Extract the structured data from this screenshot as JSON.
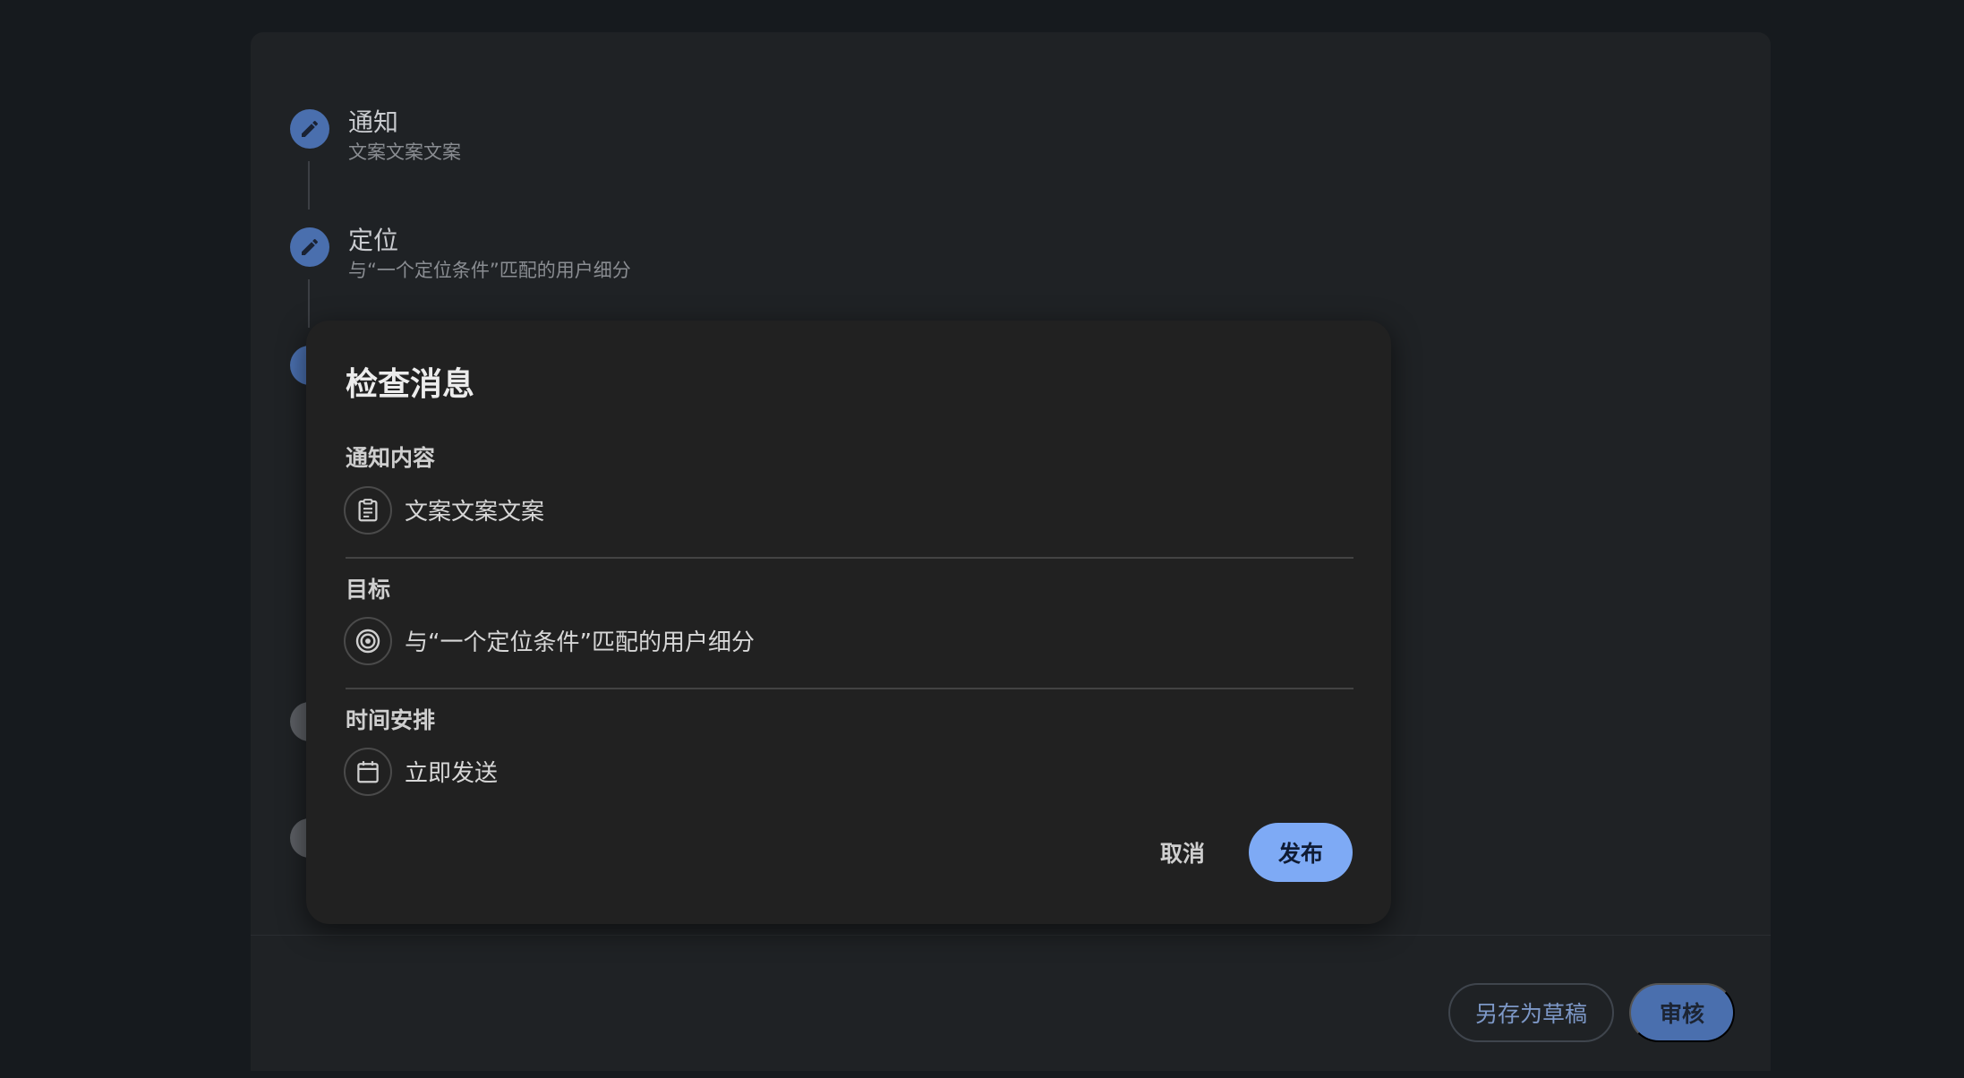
{
  "steps": [
    {
      "title": "通知",
      "subtitle": "文案文案文案",
      "icon": "pencil-icon"
    },
    {
      "title": "定位",
      "subtitle": "与“一个定位条件”匹配的用户细分",
      "icon": "pencil-icon"
    }
  ],
  "footer": {
    "save_draft_label": "另存为草稿",
    "review_label": "审核"
  },
  "dialog": {
    "title": "检查消息",
    "sections": [
      {
        "label": "通知内容",
        "value": "文案文案文案",
        "icon": "clipboard-icon"
      },
      {
        "label": "目标",
        "value": "与“一个定位条件”匹配的用户细分",
        "icon": "target-icon"
      },
      {
        "label": "时间安排",
        "value": "立即发送",
        "icon": "calendar-icon"
      }
    ],
    "cancel_label": "取消",
    "publish_label": "发布"
  },
  "colors": {
    "accent": "#7eaaf5",
    "step_active": "#4a6fae",
    "background": "#161a1e",
    "dialog_bg": "#212121"
  }
}
